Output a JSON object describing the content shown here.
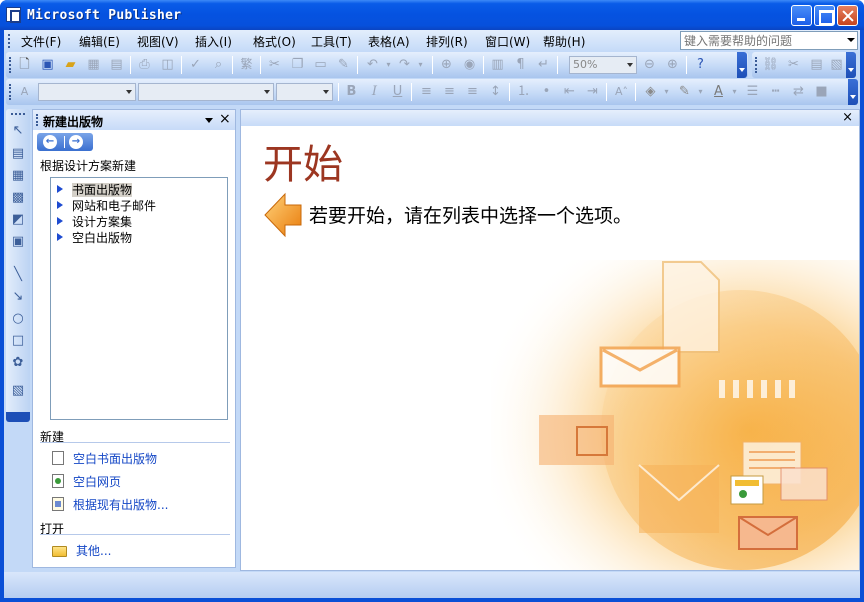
{
  "window": {
    "title": "Microsoft Publisher"
  },
  "menu": {
    "items": [
      "文件(F)",
      "编辑(E)",
      "视图(V)",
      "插入(I)",
      "格式(O)",
      "工具(T)",
      "表格(A)",
      "排列(R)",
      "窗口(W)",
      "帮助(H)"
    ],
    "help_placeholder": "键入需要帮助的问题"
  },
  "toolbar": {
    "zoom": "50%",
    "font_combo": "",
    "size_combo": "",
    "style_combo": ""
  },
  "taskpane": {
    "title": "新建出版物",
    "section_design": "根据设计方案新建",
    "tree": [
      {
        "label": "书面出版物",
        "selected": true
      },
      {
        "label": "网站和电子邮件",
        "selected": false
      },
      {
        "label": "设计方案集",
        "selected": false
      },
      {
        "label": "空白出版物",
        "selected": false
      }
    ],
    "section_new": "新建",
    "new_links": [
      "空白书面出版物",
      "空白网页",
      "根据现有出版物..."
    ],
    "section_open": "打开",
    "open_link": "其他..."
  },
  "document": {
    "heading": "开始",
    "instruction": "若要开始，请在列表中选择一个选项。"
  },
  "colors": {
    "title_bar": "#0553e1",
    "heading": "#9c3621",
    "link": "#1447c6",
    "tree_arrow": "#1e4bd1",
    "accent_orange": "#f29a1e"
  },
  "icons": [
    "new-icon",
    "web-new-icon",
    "open-icon",
    "save-icon",
    "print-icon",
    "print-preview-icon",
    "spelling-icon",
    "research-icon",
    "traditional-chinese-icon",
    "cut-icon",
    "copy-icon",
    "paste-icon",
    "format-painter-icon",
    "undo-icon",
    "redo-icon",
    "zoom-out-icon",
    "zoom-in-icon",
    "help-icon",
    "bold-icon",
    "italic-icon",
    "underline-icon",
    "align-left-icon",
    "center-icon",
    "align-right-icon",
    "line-spacing-icon",
    "numbering-icon",
    "bullets-icon",
    "decrease-indent-icon",
    "increase-indent-icon",
    "fill-color-icon",
    "line-color-icon",
    "font-color-icon"
  ]
}
